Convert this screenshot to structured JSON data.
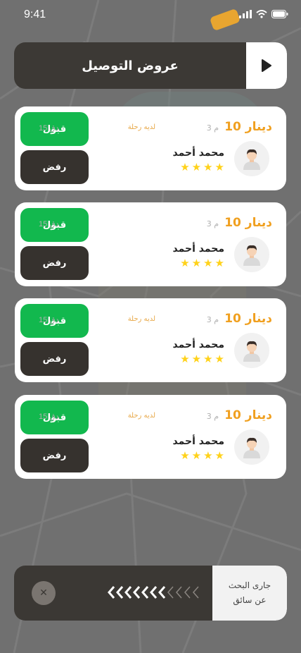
{
  "status_bar": {
    "time": "9:41"
  },
  "header": {
    "title": "عروض التوصيل",
    "play_icon": "play-icon"
  },
  "offers": [
    {
      "price": "10 دينار",
      "distance": "3 م",
      "duration": "15 دق",
      "trip_note": "لديه رحلة",
      "driver_name": "محمد أحمد",
      "rating": 4,
      "accept_label": "قبول",
      "reject_label": "رفض"
    },
    {
      "price": "10 دينار",
      "distance": "3 م",
      "duration": "15 دق",
      "trip_note": "",
      "driver_name": "محمد أحمد",
      "rating": 4,
      "accept_label": "قبول",
      "reject_label": "رفض"
    },
    {
      "price": "10 دينار",
      "distance": "3 م",
      "duration": "15 دق",
      "trip_note": "لديه رحلة",
      "driver_name": "محمد أحمد",
      "rating": 4,
      "accept_label": "قبول",
      "reject_label": "رفض"
    },
    {
      "price": "10 دينار",
      "distance": "3 م",
      "duration": "15 دق",
      "trip_note": "لديه رحلة",
      "driver_name": "محمد أحمد",
      "rating": 4,
      "accept_label": "قبول",
      "reject_label": "رفض"
    }
  ],
  "search_panel": {
    "line1": "جارى البحث",
    "line2": "عن سائق",
    "cancel_icon": "close-icon",
    "progress_filled": 7,
    "progress_total": 11
  },
  "colors": {
    "accept": "#12b84e",
    "reject": "#36322e",
    "price": "#f0a020",
    "star": "#ffd21a"
  }
}
